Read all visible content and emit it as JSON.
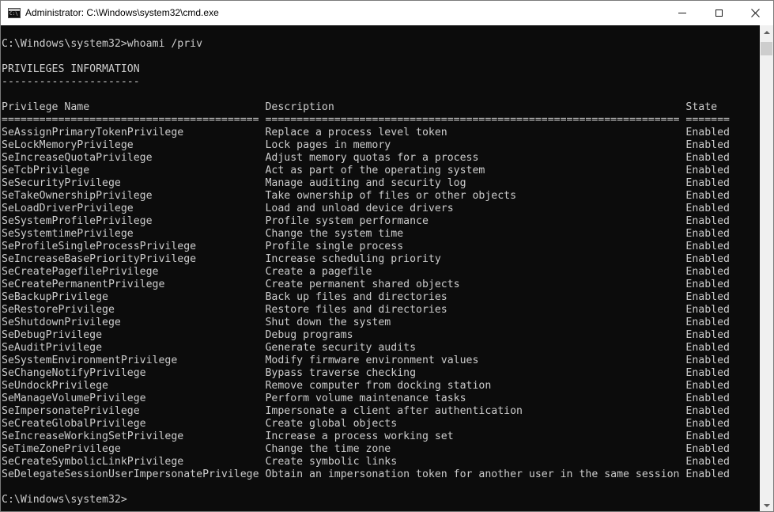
{
  "window": {
    "title": "Administrator: C:\\Windows\\system32\\cmd.exe",
    "icon": "cmd-icon",
    "icon_text": "C:\\"
  },
  "controls": {
    "minimize_icon": "minimize-icon",
    "maximize_icon": "maximize-icon",
    "close_icon": "close-icon",
    "close_glyph": "✕"
  },
  "console": {
    "lines": [
      "",
      "C:\\Windows\\system32>whoami /priv",
      "",
      "PRIVILEGES INFORMATION",
      "----------------------",
      "",
      "Privilege Name                            Description                                                        State",
      "========================================= ================================================================== =======",
      "SeAssignPrimaryTokenPrivilege             Replace a process level token                                      Enabled",
      "SeLockMemoryPrivilege                     Lock pages in memory                                               Enabled",
      "SeIncreaseQuotaPrivilege                  Adjust memory quotas for a process                                 Enabled",
      "SeTcbPrivilege                            Act as part of the operating system                                Enabled",
      "SeSecurityPrivilege                       Manage auditing and security log                                   Enabled",
      "SeTakeOwnershipPrivilege                  Take ownership of files or other objects                           Enabled",
      "SeLoadDriverPrivilege                     Load and unload device drivers                                     Enabled",
      "SeSystemProfilePrivilege                  Profile system performance                                         Enabled",
      "SeSystemtimePrivilege                     Change the system time                                             Enabled",
      "SeProfileSingleProcessPrivilege           Profile single process                                             Enabled",
      "SeIncreaseBasePriorityPrivilege           Increase scheduling priority                                       Enabled",
      "SeCreatePagefilePrivilege                 Create a pagefile                                                  Enabled",
      "SeCreatePermanentPrivilege                Create permanent shared objects                                    Enabled",
      "SeBackupPrivilege                         Back up files and directories                                      Enabled",
      "SeRestorePrivilege                        Restore files and directories                                      Enabled",
      "SeShutdownPrivilege                       Shut down the system                                               Enabled",
      "SeDebugPrivilege                          Debug programs                                                     Enabled",
      "SeAuditPrivilege                          Generate security audits                                           Enabled",
      "SeSystemEnvironmentPrivilege              Modify firmware environment values                                 Enabled",
      "SeChangeNotifyPrivilege                   Bypass traverse checking                                           Enabled",
      "SeUndockPrivilege                         Remove computer from docking station                               Enabled",
      "SeManageVolumePrivilege                   Perform volume maintenance tasks                                   Enabled",
      "SeImpersonatePrivilege                    Impersonate a client after authentication                          Enabled",
      "SeCreateGlobalPrivilege                   Create global objects                                              Enabled",
      "SeIncreaseWorkingSetPrivilege             Increase a process working set                                     Enabled",
      "SeTimeZonePrivilege                       Change the time zone                                               Enabled",
      "SeCreateSymbolicLinkPrivilege             Create symbolic links                                              Enabled",
      "SeDelegateSessionUserImpersonatePrivilege Obtain an impersonation token for another user in the same session Enabled",
      "",
      "C:\\Windows\\system32>"
    ]
  },
  "scrollbar": {
    "up_icon": "scroll-up-arrow-icon",
    "down_icon": "scroll-down-arrow-icon"
  },
  "colors": {
    "console_background": "#0c0c0c",
    "console_text": "#cccccc",
    "titlebar_background": "#ffffff"
  }
}
